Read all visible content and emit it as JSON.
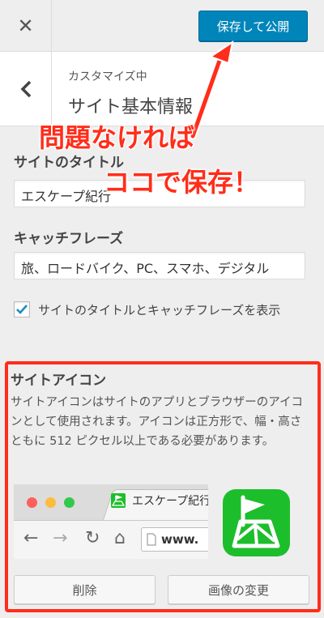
{
  "topbar": {
    "close_label": "✕",
    "publish_label": "保存して公開",
    "publish_color": "#0085ba"
  },
  "header": {
    "back_icon": "chevron-left-icon",
    "subtitle": "カスタマイズ中",
    "title": "サイト基本情報"
  },
  "site_title": {
    "label": "サイトのタイトル",
    "value": "エスケープ紀行"
  },
  "tagline": {
    "label": "キャッチフレーズ",
    "value": "旅、ロードバイク、PC、スマホ、デジタル"
  },
  "display_header_text": {
    "checked": true,
    "label": "サイトのタイトルとキャッチフレーズを表示"
  },
  "site_icon": {
    "title": "サイトアイコン",
    "description": "サイトアイコンはサイトのアプリとブラウザーのアイコンとして使用されます。アイコンは正方形で、幅・高さともに 512 ピクセル以上である必要があります。",
    "preview_tab_text": "エスケープ紀行",
    "preview_url_text": "www.",
    "app_icon_color": "#1dbe2b",
    "remove_label": "削除",
    "change_label": "画像の変更"
  },
  "annotation": {
    "line1": "問題なければ",
    "line2": "ココで保存！",
    "color": "#ff2d1a"
  }
}
